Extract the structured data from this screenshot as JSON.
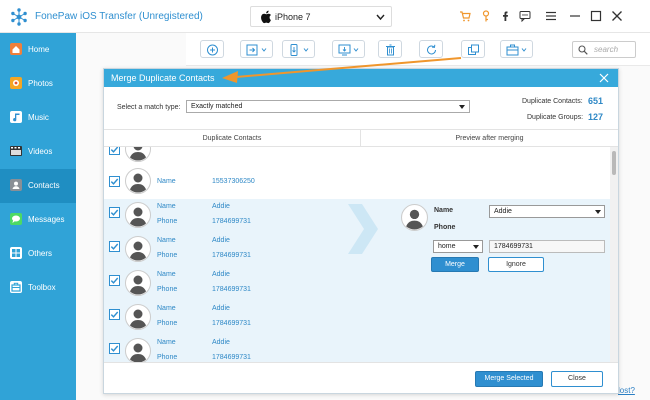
{
  "app": {
    "title": "FonePaw iOS Transfer (Unregistered)",
    "device": "iPhone 7",
    "brand_color": "#30a3d7",
    "accent_color": "#f0962c"
  },
  "titlebar_icons": [
    "cart-icon",
    "key-icon",
    "facebook-icon",
    "feedback-icon",
    "menu-icon",
    "minimize-icon",
    "maximize-icon",
    "close-icon"
  ],
  "sidebar": {
    "items": [
      {
        "label": "Home",
        "icon": "home-icon",
        "active": false
      },
      {
        "label": "Photos",
        "icon": "photos-icon",
        "active": false
      },
      {
        "label": "Music",
        "icon": "music-icon",
        "active": false
      },
      {
        "label": "Videos",
        "icon": "videos-icon",
        "active": false
      },
      {
        "label": "Contacts",
        "icon": "contacts-icon",
        "active": true
      },
      {
        "label": "Messages",
        "icon": "messages-icon",
        "active": false
      },
      {
        "label": "Others",
        "icon": "others-icon",
        "active": false
      },
      {
        "label": "Toolbox",
        "icon": "toolbox-icon",
        "active": false
      }
    ]
  },
  "toolbar": {
    "buttons": [
      "add-icon",
      "import-icon",
      "export-to-device-icon",
      "export-to-pc-icon",
      "delete-icon",
      "refresh-icon",
      "deduplicate-icon",
      "toolbox-icon"
    ],
    "search_placeholder": "search"
  },
  "footer_link": "lost?",
  "dialog": {
    "title": "Merge Duplicate Contacts",
    "match_type_label": "Select a match type:",
    "match_type_value": "Exactly matched",
    "duplicate_contacts_label": "Duplicate Contacts:",
    "duplicate_contacts_value": "651",
    "duplicate_groups_label": "Duplicate Groups:",
    "duplicate_groups_value": "127",
    "col_left": "Duplicate Contacts",
    "col_right": "Preview after merging",
    "rows": [
      {
        "name_label": "Name",
        "name": "",
        "phone_label": "Phone",
        "phone": "15537306250"
      },
      {
        "name_label": "Name",
        "name": "",
        "phone_label": "",
        "phone": "15537306250"
      },
      {
        "name_label": "Name",
        "name": "Addie",
        "phone_label": "Phone",
        "phone": "1784699731"
      },
      {
        "name_label": "Name",
        "name": "Addie",
        "phone_label": "Phone",
        "phone": "1784699731"
      },
      {
        "name_label": "Name",
        "name": "Addie",
        "phone_label": "Phone",
        "phone": "1784699731"
      },
      {
        "name_label": "Name",
        "name": "Addie",
        "phone_label": "Phone",
        "phone": "1784699731"
      },
      {
        "name_label": "Name",
        "name": "Addie",
        "phone_label": "Phone",
        "phone": "1784699731"
      }
    ],
    "preview": {
      "name_label": "Name",
      "name_value": "Addie",
      "phone_label": "Phone",
      "phone_type": "home",
      "phone_value": "1784699731",
      "merge_label": "Merge",
      "ignore_label": "Ignore"
    },
    "merge_selected_label": "Merge Selected",
    "close_label": "Close"
  }
}
